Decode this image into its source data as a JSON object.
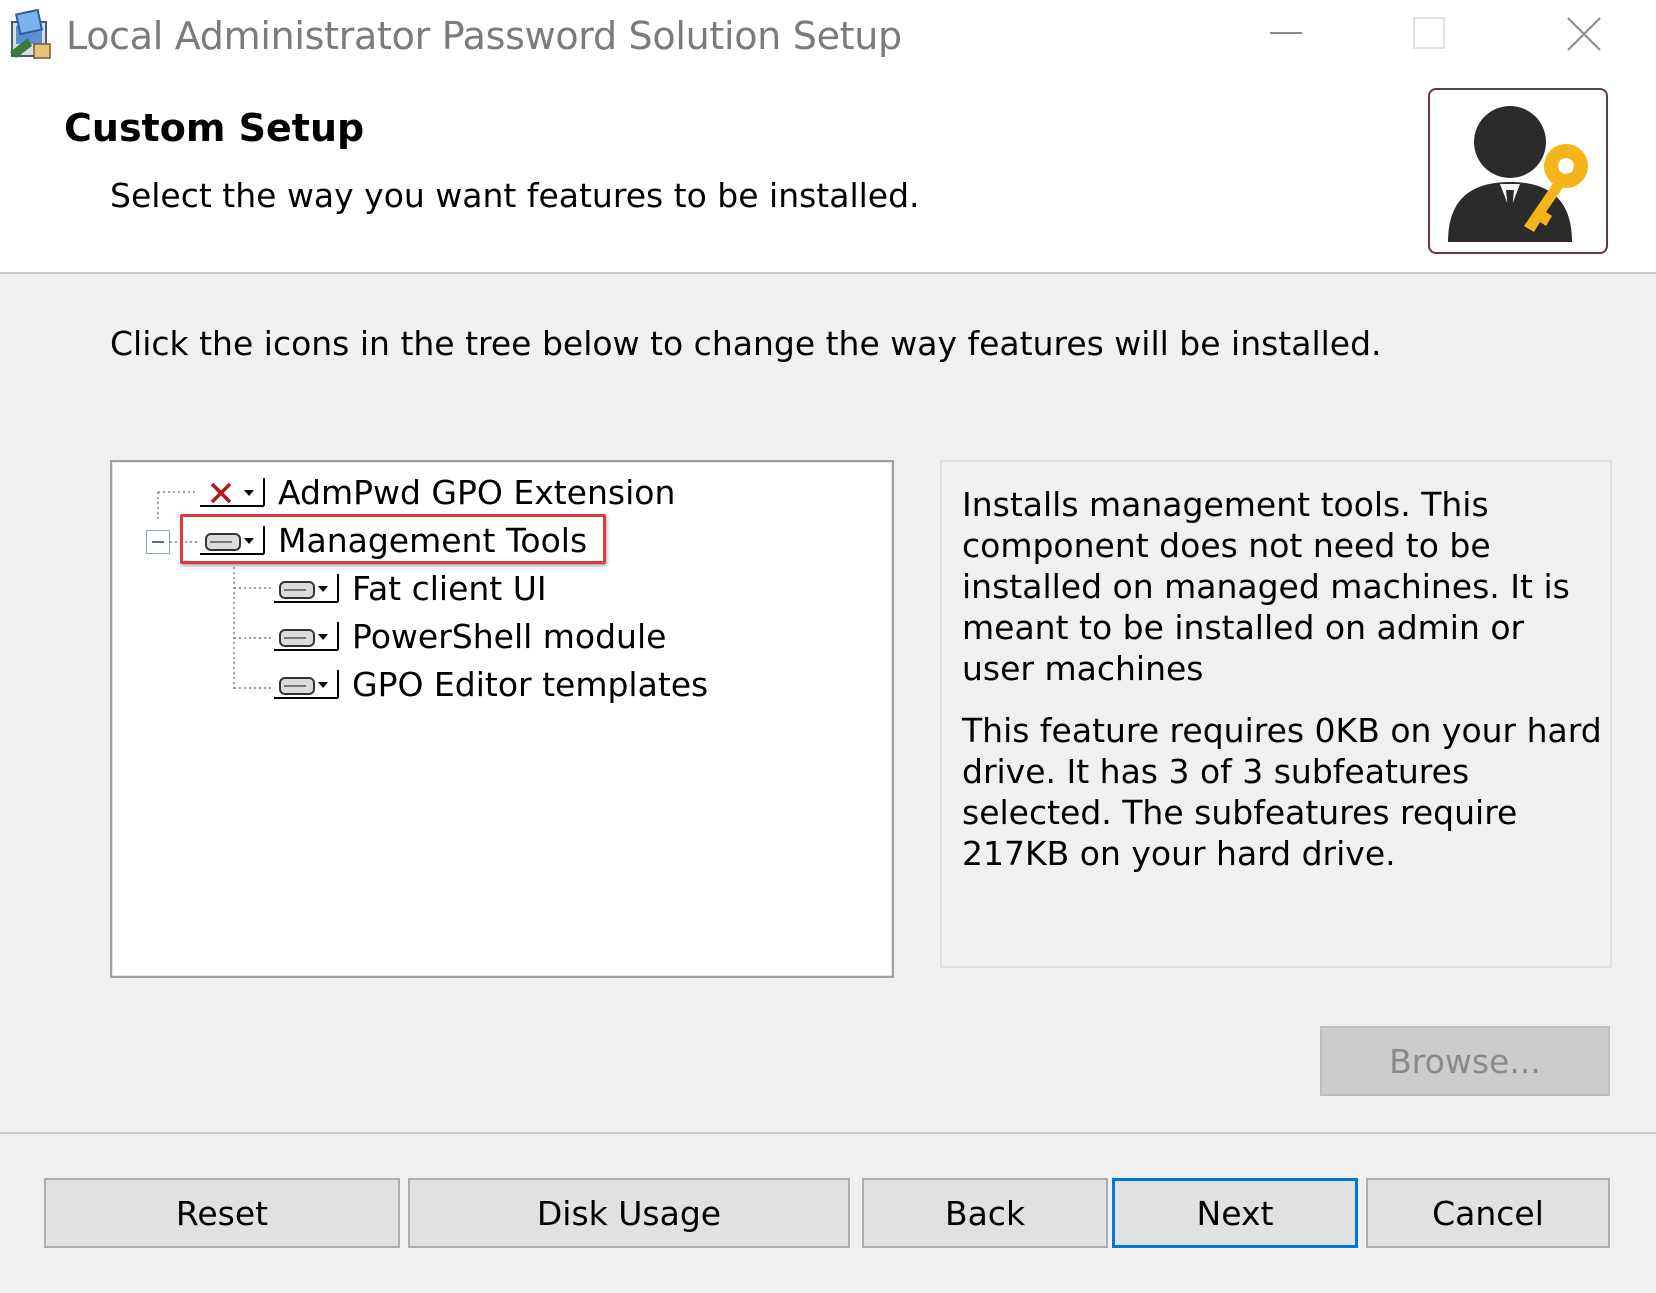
{
  "window": {
    "title": "Local Administrator Password Solution Setup",
    "controls": [
      "minimize-icon",
      "maximize-icon",
      "close-icon"
    ]
  },
  "header": {
    "title": "Custom Setup",
    "subtitle": "Select the way you want features to be installed.",
    "banner_icon": "admin-user-with-key-icon"
  },
  "instructions": "Click the icons in the tree below to change the way features will be installed.",
  "tree": {
    "items": [
      {
        "label": "AdmPwd GPO Extension",
        "state": "not-installed",
        "icon": "red-x-icon",
        "level": 0
      },
      {
        "label": "Management Tools",
        "state": "install-local",
        "icon": "hard-drive-icon",
        "level": 0,
        "expanded": true,
        "highlighted": true
      },
      {
        "label": "Fat client UI",
        "state": "install-local",
        "icon": "hard-drive-icon",
        "level": 1
      },
      {
        "label": "PowerShell module",
        "state": "install-local",
        "icon": "hard-drive-icon",
        "level": 1
      },
      {
        "label": "GPO Editor templates",
        "state": "install-local",
        "icon": "hard-drive-icon",
        "level": 1
      }
    ]
  },
  "description": {
    "summary": "Installs management tools. This component does not need to be installed on managed machines. It is meant to be installed on admin or user machines",
    "disk_info": "This feature requires 0KB on your hard drive. It has 3 of 3 subfeatures selected. The subfeatures require 217KB on your hard drive."
  },
  "buttons": {
    "browse": "Browse...",
    "reset": "Reset",
    "disk_usage": "Disk Usage",
    "back": "Back",
    "next": "Next",
    "cancel": "Cancel"
  },
  "colors": {
    "highlight": "#e03a3a",
    "default_button_border": "#0078d7",
    "key_gold": "#f4b41a"
  }
}
